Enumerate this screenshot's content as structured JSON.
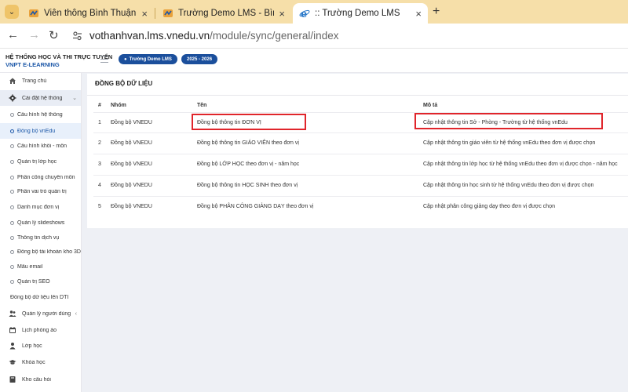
{
  "browser": {
    "tabs": [
      {
        "title": "Viễn thông Bình Thuận - Bình T",
        "active": false
      },
      {
        "title": "Trường Demo LMS - Bình Thuậ",
        "active": false
      },
      {
        "title": ":: Trường Demo LMS",
        "active": true
      }
    ],
    "new_tab_label": "+",
    "url_host": "vothanhvan.lms.vnedu.vn",
    "url_path": "/module/sync/general/index"
  },
  "header": {
    "brand_line1": "HỆ THỐNG HỌC VÀ THI TRỰC TUYẾN",
    "brand_line2": "VNPT E-LEARNING",
    "school_pill": "Trường Demo LMS",
    "year_pill": "2025 - 2026"
  },
  "sidebar": {
    "items": [
      {
        "label": "Trang chủ",
        "icon": "home-icon",
        "kind": "top"
      },
      {
        "label": "Cài đặt hệ thống",
        "icon": "gear-icon",
        "kind": "group-open"
      },
      {
        "label": "Cấu hình hệ thống",
        "kind": "sub"
      },
      {
        "label": "Đồng bộ vnEdu",
        "kind": "sub-active"
      },
      {
        "label": "Cấu hình khối - môn",
        "kind": "sub"
      },
      {
        "label": "Quản trị lớp học",
        "kind": "sub"
      },
      {
        "label": "Phân công chuyên môn",
        "kind": "sub"
      },
      {
        "label": "Phân vai trò quản trị",
        "kind": "sub"
      },
      {
        "label": "Danh mục đơn vị",
        "kind": "sub"
      },
      {
        "label": "Quản lý slideshows",
        "kind": "sub"
      },
      {
        "label": "Thông tin dịch vụ",
        "kind": "sub"
      },
      {
        "label": "Đồng bộ tài khoản kho 3D",
        "kind": "sub"
      },
      {
        "label": "Mẫu email",
        "kind": "sub"
      },
      {
        "label": "Quản trị SEO",
        "kind": "sub"
      },
      {
        "label": "Đồng bộ dữ liệu lên DTI",
        "kind": "plain"
      },
      {
        "label": "Quản lý người dùng",
        "icon": "users-icon",
        "kind": "group"
      },
      {
        "label": "Lịch phòng ảo",
        "icon": "calendar-icon",
        "kind": "top"
      },
      {
        "label": "Lớp học",
        "icon": "person-icon",
        "kind": "top"
      },
      {
        "label": "Khóa học",
        "icon": "graduation-cap-icon",
        "kind": "top"
      },
      {
        "label": "Kho câu hỏi",
        "icon": "book-icon",
        "kind": "top"
      }
    ]
  },
  "main": {
    "title": "ĐỒNG BỘ DỮ LIỆU",
    "columns": [
      "#",
      "Nhóm",
      "Tên",
      "Mô tả"
    ],
    "rows": [
      {
        "num": "1",
        "group": "Đồng bộ VNEDU",
        "name": "Đồng bộ thông tin ĐƠN VỊ",
        "desc": "Cập nhật thông tin Sở - Phòng - Trường từ hệ thống vnEdu"
      },
      {
        "num": "2",
        "group": "Đồng bộ VNEDU",
        "name": "Đồng bộ thông tin GIÁO VIÊN theo đơn vị",
        "desc": "Cập nhật thông tin giáo viên từ hệ thống vnEdu theo đơn vị được chọn"
      },
      {
        "num": "3",
        "group": "Đồng bộ VNEDU",
        "name": "Đồng bộ LỚP HỌC theo đơn vị - năm học",
        "desc": "Cập nhật thông tin lớp học từ hệ thống vnEdu theo đơn vị được chọn - năm học"
      },
      {
        "num": "4",
        "group": "Đồng bộ VNEDU",
        "name": "Đồng bộ thông tin HỌC SINH theo đơn vị",
        "desc": "Cập nhật thông tin học sinh từ hệ thống vnEdu theo đơn vị được chọn"
      },
      {
        "num": "5",
        "group": "Đồng bộ VNEDU",
        "name": "Đồng bộ PHÂN CÔNG GIẢNG DẠY theo đơn vị",
        "desc": "Cập nhật phân công giảng dạy theo đơn vị được chọn"
      }
    ]
  },
  "colors": {
    "brand_blue": "#1d58a8",
    "pill_blue": "#1b4f9c",
    "highlight_red": "#e0252b",
    "tabstrip": "#f6dfa9"
  }
}
